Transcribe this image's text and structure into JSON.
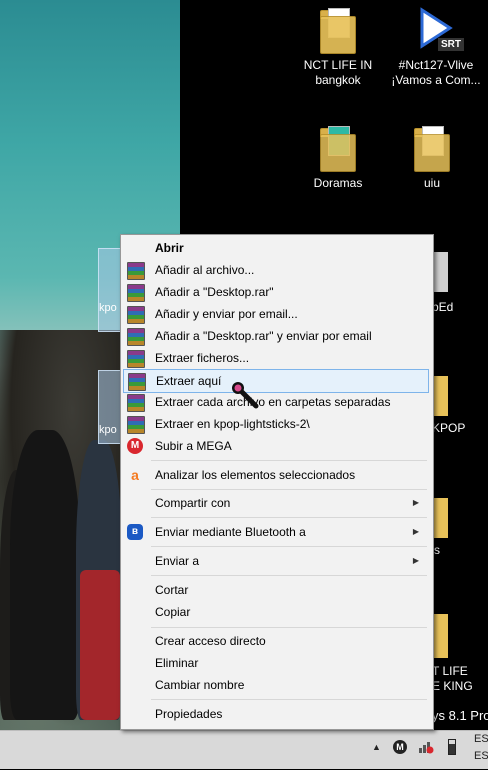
{
  "desktop": {
    "icons": [
      {
        "label": "NCT LIFE IN bangkok",
        "line1": "NCT LIFE IN",
        "line2": "bangkok"
      },
      {
        "label": "#Nct127-Vlive ¡Vamos a Com...",
        "line1": "#Nct127-Vlive",
        "line2": "¡Vamos a Com...",
        "badge": "SRT"
      },
      {
        "label": "Doramas"
      },
      {
        "label": "uiu"
      }
    ],
    "partial_labels": {
      "left_kpo_1": "kpo",
      "left_kpo_2": "kpo",
      "right_bed": "bEd",
      "right_kpop": "KPOP",
      "right_s": "s",
      "right_life1": "T LIFE",
      "right_life2": "E KING",
      "os": "ys 8.1 Pro"
    }
  },
  "context_menu": {
    "items": [
      {
        "label": "Abrir",
        "bold": true
      },
      {
        "label": "Añadir al archivo...",
        "icon": "winrar-icon"
      },
      {
        "label": "Añadir a \"Desktop.rar\"",
        "icon": "winrar-icon"
      },
      {
        "label": "Añadir y enviar por email...",
        "icon": "winrar-icon"
      },
      {
        "label": "Añadir a \"Desktop.rar\" y enviar por email",
        "icon": "winrar-icon"
      },
      {
        "label": "Extraer ficheros...",
        "icon": "winrar-icon"
      },
      {
        "label": "Extraer aquí",
        "icon": "winrar-icon",
        "highlighted": true
      },
      {
        "label": "Extraer cada archivo en carpetas separadas",
        "icon": "winrar-icon"
      },
      {
        "label": "Extraer en kpop-lightsticks-2\\",
        "icon": "winrar-icon"
      },
      {
        "label": "Subir a MEGA",
        "icon": "mega-icon"
      },
      {
        "label": "Analizar los elementos seleccionados",
        "icon": "avast-icon"
      },
      {
        "label": "Compartir con",
        "submenu": true
      },
      {
        "label": "Enviar mediante Bluetooth a",
        "icon": "bluetooth-icon",
        "submenu": true
      },
      {
        "label": "Enviar a",
        "submenu": true
      },
      {
        "label": "Cortar"
      },
      {
        "label": "Copiar"
      },
      {
        "label": "Crear acceso directo"
      },
      {
        "label": "Eliminar"
      },
      {
        "label": "Cambiar nombre"
      },
      {
        "label": "Propiedades"
      }
    ]
  },
  "taskbar": {
    "lang_top": "ESI",
    "lang_bottom": "ES"
  },
  "icons": {
    "mega_letter": "M",
    "bt_letter": "ʙ",
    "avast_letter": "a",
    "submenu_arrow": "▶",
    "tray_up": "▲"
  }
}
